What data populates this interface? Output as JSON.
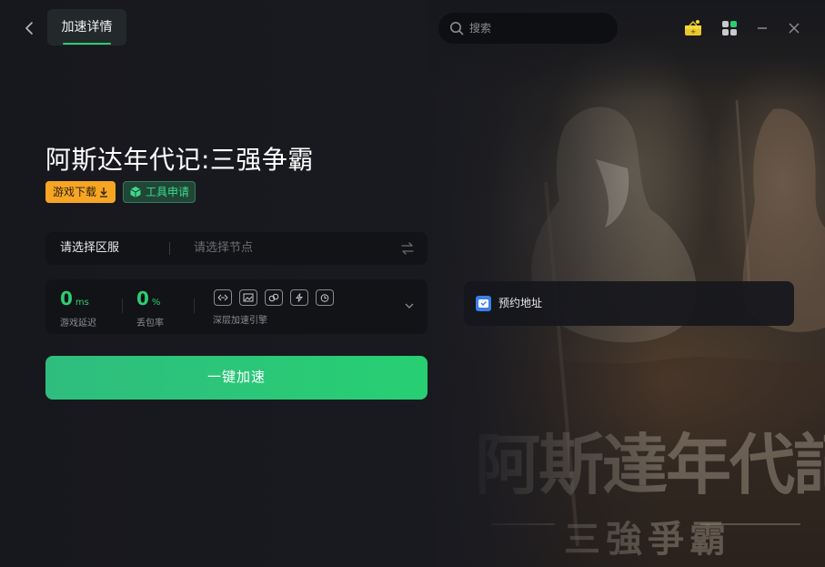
{
  "header": {
    "back_icon": "chevron-left-icon",
    "tab_label": "加速详情",
    "search_placeholder": "搜索",
    "gift_icon": "gift-box-icon",
    "apps_icon": "apps-grid-icon",
    "minimize_icon": "minimize-icon",
    "close_icon": "close-icon"
  },
  "game": {
    "title": "阿斯达年代记:三强争霸",
    "download_label": "游戏下载",
    "tool_label": "工具申请"
  },
  "server": {
    "region_placeholder": "请选择区服",
    "node_placeholder": "请选择节点",
    "swap_icon": "swap-arrows-icon"
  },
  "stats": {
    "latency_value": "0",
    "latency_unit": "ms",
    "latency_label": "游戏延迟",
    "loss_value": "0",
    "loss_unit": "%",
    "loss_label": "丢包率",
    "engine_label": "深层加速引擎",
    "engine_icons": [
      "route-icon",
      "image-icon",
      "link-icon",
      "bolt-icon",
      "timer-icon"
    ]
  },
  "action": {
    "accelerate_label": "一键加速"
  },
  "reserve": {
    "label": "预约地址"
  },
  "art": {
    "title": "阿斯達年代記",
    "subtitle": "三強爭霸"
  },
  "colors": {
    "accent_green": "#2ecc71",
    "download_orange": "#f6a623",
    "background": "#191a20"
  }
}
